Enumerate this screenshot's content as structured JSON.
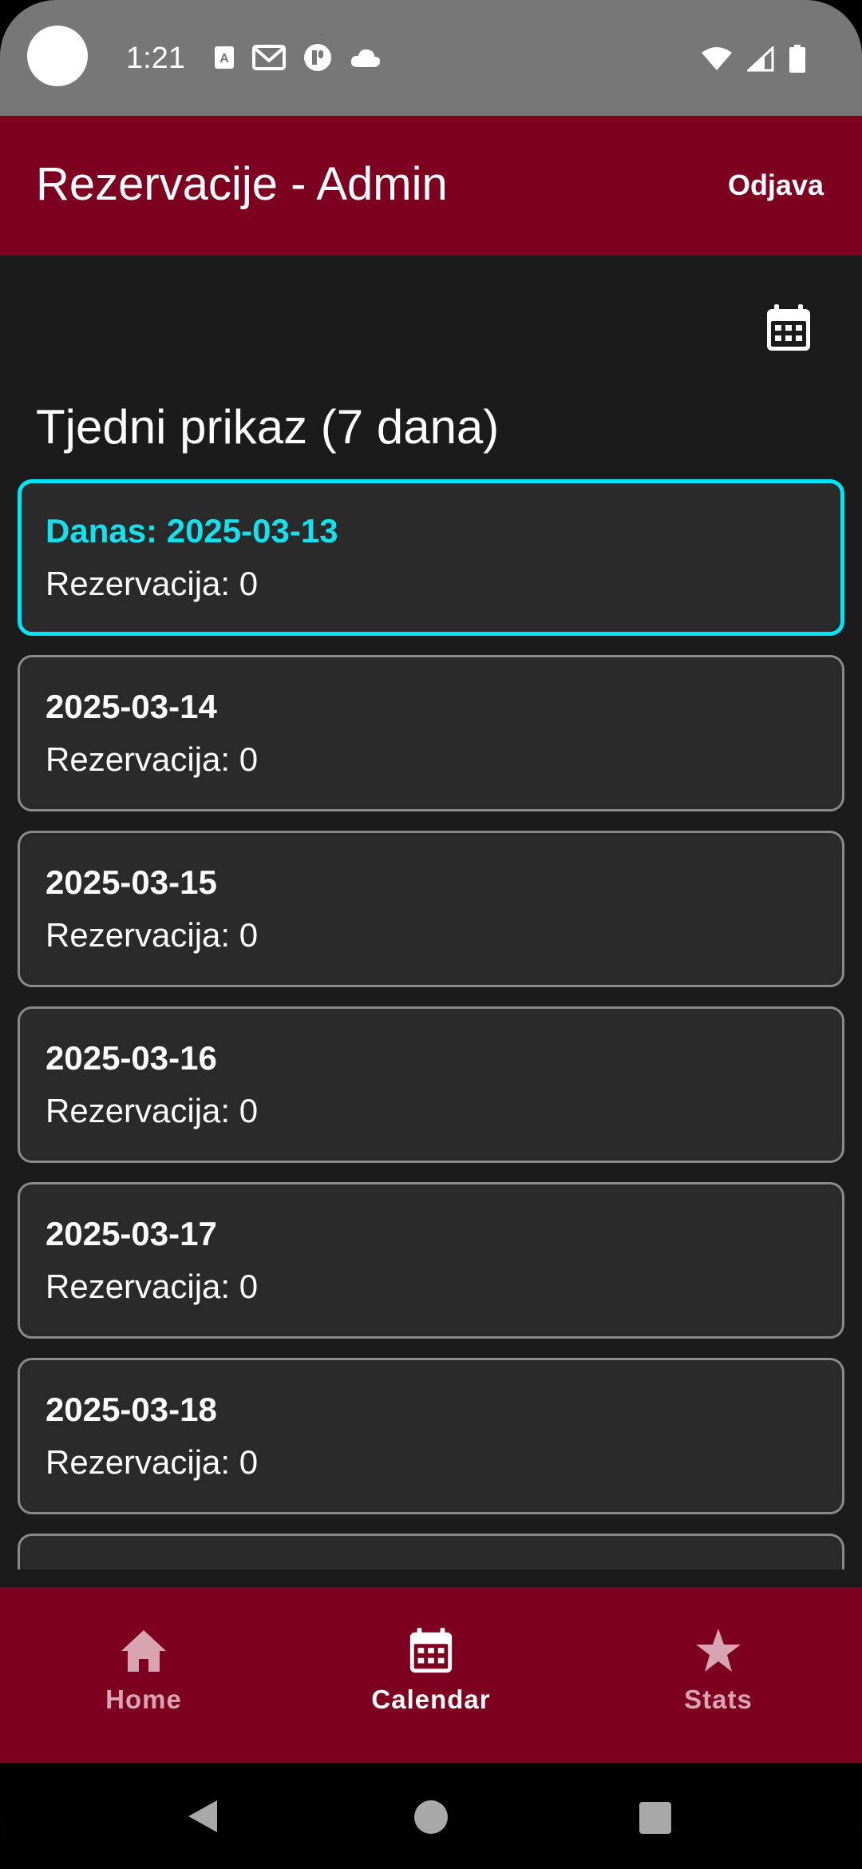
{
  "status_bar": {
    "time": "1:21",
    "icons_left": [
      "font-icon",
      "gmail-icon",
      "app-icon",
      "cloud-icon"
    ],
    "icons_right": [
      "wifi-icon",
      "signal-icon",
      "battery-icon"
    ]
  },
  "app_bar": {
    "title": "Rezervacije - Admin",
    "logout_label": "Odjava",
    "color": "#7d0020"
  },
  "content": {
    "calendar_icon": "calendar-icon",
    "section_title": "Tjedni prikaz (7 dana)",
    "days": [
      {
        "date": "Danas: 2025-03-13",
        "count": "Rezervacija: 0",
        "today": true
      },
      {
        "date": "2025-03-14",
        "count": "Rezervacija: 0"
      },
      {
        "date": "2025-03-15",
        "count": "Rezervacija: 0"
      },
      {
        "date": "2025-03-16",
        "count": "Rezervacija: 0"
      },
      {
        "date": "2025-03-17",
        "count": "Rezervacija: 0"
      },
      {
        "date": "2025-03-18",
        "count": "Rezervacija: 0"
      }
    ],
    "today_accent": "#00e5f5"
  },
  "bottom_nav": {
    "items": [
      {
        "label": "Home",
        "icon": "home-icon",
        "active": false
      },
      {
        "label": "Calendar",
        "icon": "calendar-icon",
        "active": true
      },
      {
        "label": "Stats",
        "icon": "star-icon",
        "active": false
      }
    ]
  }
}
